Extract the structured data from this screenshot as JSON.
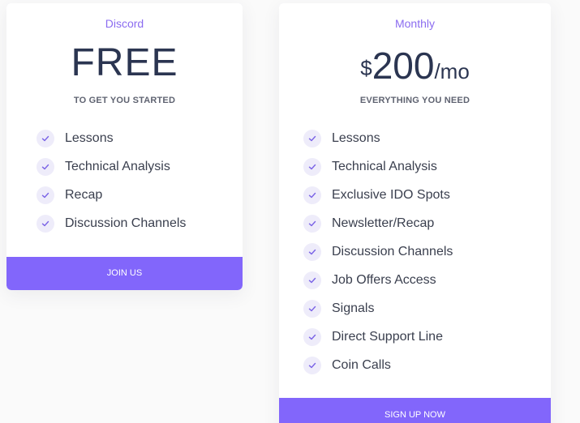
{
  "plans": [
    {
      "name": "Discord",
      "price": "FREE",
      "subtitle": "TO GET YOU STARTED",
      "features": [
        "Lessons",
        "Technical Analysis",
        "Recap",
        "Discussion Channels"
      ],
      "cta": "JOIN US"
    },
    {
      "name": "Monthly",
      "currency": "$",
      "price": "200",
      "period": "/mo",
      "subtitle": "EVERYTHING YOU NEED",
      "features": [
        "Lessons",
        "Technical Analysis",
        "Exclusive IDO Spots",
        "Newsletter/Recap",
        "Discussion Channels",
        "Job Offers Access",
        "Signals",
        "Direct Support Line",
        "Coin Calls"
      ],
      "cta": "SIGN UP NOW"
    }
  ],
  "colors": {
    "accent": "#8266fb",
    "plan_name": "#8b6cf0",
    "price": "#2b3551",
    "check_bg": "#eeecfa"
  },
  "icons": {
    "feature": "check-icon"
  }
}
